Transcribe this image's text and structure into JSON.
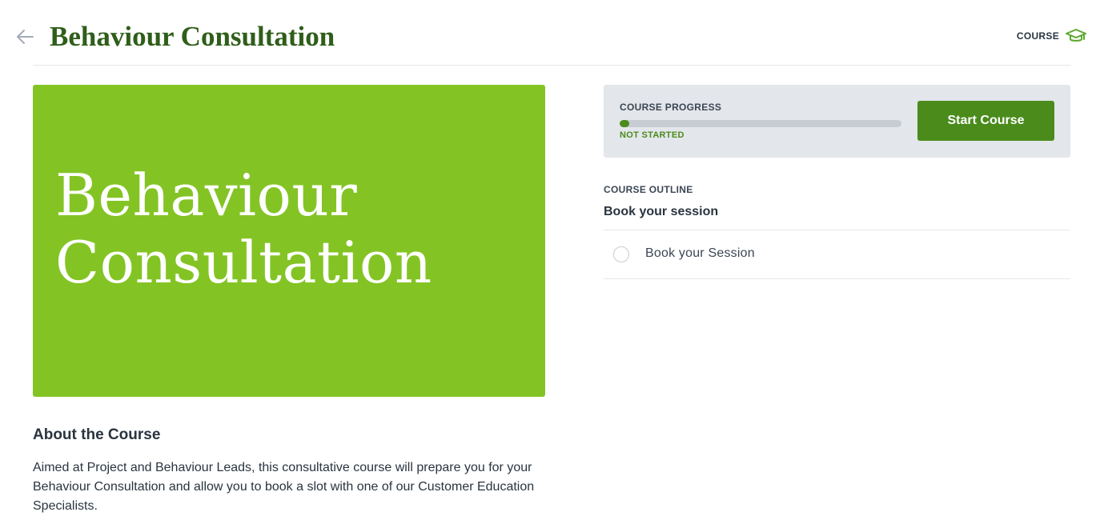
{
  "header": {
    "title": "Behaviour Consultation",
    "type_label": "COURSE"
  },
  "banner": {
    "line1": "Behaviour",
    "line2": "Consultation"
  },
  "about": {
    "heading": "About the Course",
    "text": "Aimed at Project and Behaviour Leads, this consultative course will prepare you for your Behaviour Consultation and allow you to book a slot with one of our Customer Education Specialists."
  },
  "progress": {
    "label": "COURSE PROGRESS",
    "percent": 0,
    "status": "NOT STARTED",
    "button_label": "Start Course"
  },
  "outline": {
    "label": "COURSE OUTLINE",
    "section_title": "Book your session",
    "lessons": [
      {
        "label": "Book your Session",
        "completed": false
      }
    ]
  },
  "colors": {
    "title_green": "#2f5e1a",
    "accent_green": "#4a8b1c",
    "banner_green": "#83c424",
    "icon_green": "#5aa82a",
    "card_bg": "#e3e6ea"
  },
  "icons": {
    "back": "arrow-left-icon",
    "course_type": "graduation-cap-icon",
    "lesson_status": "radio-empty-icon"
  }
}
